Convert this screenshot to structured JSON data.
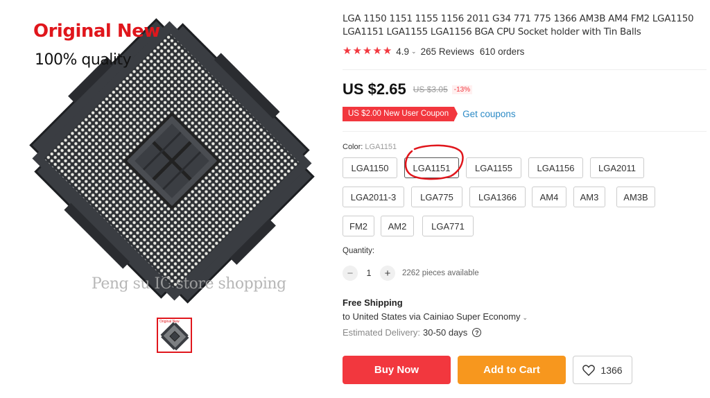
{
  "gallery": {
    "overlay_title": "Original New",
    "overlay_subtitle": "100% quality",
    "watermark": "Peng su IC store shopping",
    "thumbnail_text": "Original New",
    "icons": [
      "cpu-socket-image",
      "thumbnail-image"
    ]
  },
  "product": {
    "title": "LGA 1150 1151 1155 1156 2011 G34 771 775 1366 AM3B AM4 FM2 LGA1150 LGA1151 LGA1155 LGA1156 BGA CPU Socket holder with Tin Balls",
    "rating": "4.9",
    "reviews": "265 Reviews",
    "orders": "610 orders",
    "price": "US $2.65",
    "old_price": "US $3.05",
    "discount": "-13%",
    "coupon": "US $2.00 New User Coupon",
    "get_coupons": "Get coupons"
  },
  "color": {
    "label": "Color:",
    "selected": "LGA1151",
    "options": [
      "LGA1150",
      "LGA1151",
      "LGA1155",
      "LGA1156",
      "LGA2011",
      "LGA2011-3",
      "LGA775",
      "LGA1366",
      "AM4",
      "AM3",
      "AM3B",
      "FM2",
      "AM2",
      "LGA771"
    ]
  },
  "quantity": {
    "label": "Quantity:",
    "value": "1",
    "minus": "−",
    "plus": "+",
    "available": "2262 pieces available"
  },
  "shipping": {
    "title": "Free Shipping",
    "destination": "to United States via Cainiao Super Economy",
    "delivery_label": "Estimated Delivery:",
    "delivery_days": "30-50 days",
    "help": "?"
  },
  "actions": {
    "buy_now": "Buy Now",
    "add_to_cart": "Add to Cart",
    "wishlist_count": "1366"
  },
  "colors": {
    "accent_red": "#f2373e",
    "cart_orange": "#f7971e",
    "link_blue": "#2b8ac6"
  }
}
